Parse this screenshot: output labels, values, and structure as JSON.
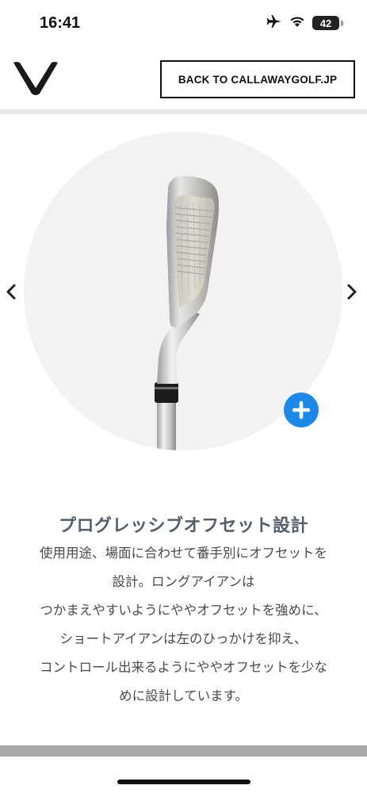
{
  "status_bar": {
    "time": "16:41",
    "battery_level": "42",
    "icons": [
      "airplane-icon",
      "wifi-icon",
      "battery-icon"
    ]
  },
  "header": {
    "logo": "callaway-chevron-logo",
    "back_button_label": "BACK TO CALLAWAYGOLF.JP"
  },
  "carousel": {
    "prev_icon": "chevron-left-icon",
    "next_icon": "chevron-right-icon",
    "zoom_icon": "plus-icon",
    "image": "golf-iron-club-head",
    "zoom_color": "#1e88e8"
  },
  "feature": {
    "title": "プログレッシブオフセット設計",
    "lines": [
      "使用用途、場面に合わせて番手別にオフセットを",
      "設計。ロングアイアンは",
      "つかまえやすいようにややオフセットを強めに、",
      "ショートアイアンは左のひっかけを抑え、",
      "コントロール出来るようにややオフセットを少な",
      "めに設計しています。"
    ]
  }
}
